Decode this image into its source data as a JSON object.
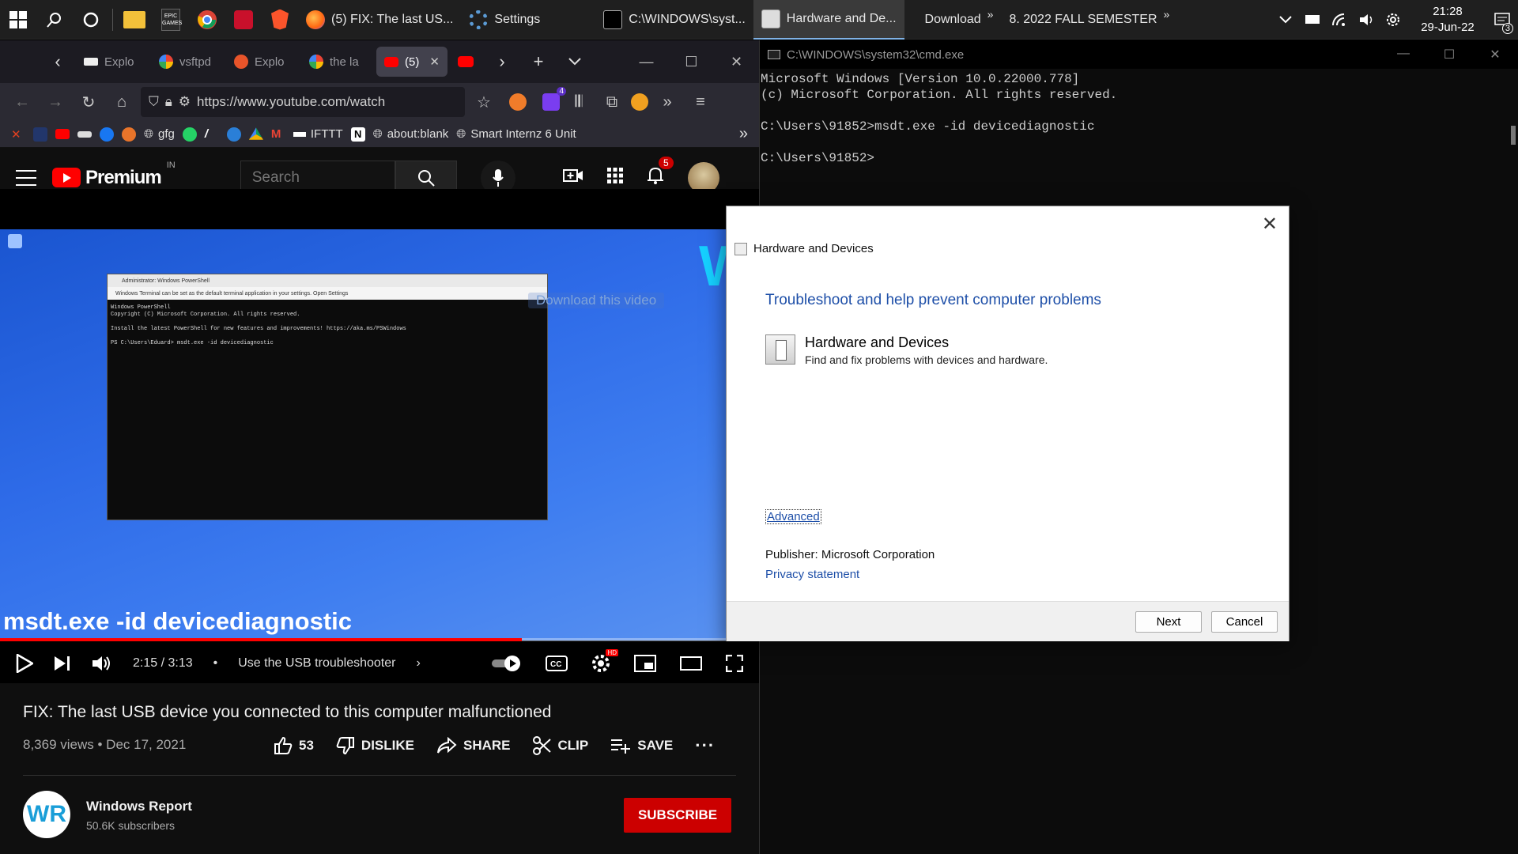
{
  "taskbar": {
    "apps": [
      {
        "label": "(5) FIX: The last US...",
        "icon": "firefox-icon"
      },
      {
        "label": "Settings",
        "icon": "gear-icon"
      },
      {
        "label": "C:\\WINDOWS\\syst...",
        "icon": "cmd-icon"
      },
      {
        "label": "Hardware and De...",
        "icon": "troubleshooter-icon"
      },
      {
        "label": "Download",
        "icon": "folder-icon"
      },
      {
        "label": "8. 2022 FALL SEMESTER",
        "icon": "folder-icon"
      }
    ],
    "clock": {
      "time": "21:28",
      "date": "29-Jun-22"
    },
    "notification_count": "3"
  },
  "browser": {
    "tabs": [
      {
        "label": "Explo"
      },
      {
        "label": "vsftpd"
      },
      {
        "label": "Explo"
      },
      {
        "label": "the la"
      },
      {
        "label": "(5)"
      }
    ],
    "url": "https://www.youtube.com/watch",
    "extension_badge": "4",
    "bookmarks": [
      {
        "label": "gfg"
      },
      {
        "label": "IFTTT"
      },
      {
        "label": "about:blank"
      },
      {
        "label": "Smart Internz 6 Unit"
      }
    ]
  },
  "youtube": {
    "logo_text": "Premium",
    "country": "IN",
    "search_placeholder": "Search",
    "notification_count": "5",
    "video": {
      "caption": "msdt.exe -id devicediagnostic",
      "overlay_download": "Download this video",
      "watermark": "W",
      "progress": 0.687,
      "time": "2:15 / 3:13",
      "chapter": "Use the USB troubleshooter",
      "inner_terminal_title": "Administrator: Windows PowerShell",
      "inner_terminal_info": "Windows Terminal can be set as the default terminal application in your settings.   Open Settings",
      "inner_terminal_lines": "Windows PowerShell\nCopyright (C) Microsoft Corporation. All rights reserved.\n\nInstall the latest PowerShell for new features and improvements! https://aka.ms/PSWindows\n\nPS C:\\Users\\Eduard> msdt.exe -id devicediagnostic"
    },
    "title": "FIX: The last USB device you connected to this computer malfunctioned",
    "meta": "8,369 views • Dec 17, 2021",
    "actions": {
      "likes": "53",
      "dislike": "DISLIKE",
      "share": "SHARE",
      "clip": "CLIP",
      "save": "SAVE"
    },
    "channel": {
      "name": "Windows Report",
      "subscribers": "50.6K subscribers",
      "avatar_text": "WR"
    },
    "subscribe_label": "SUBSCRIBE"
  },
  "cmd": {
    "title": "C:\\WINDOWS\\system32\\cmd.exe",
    "output": "Microsoft Windows [Version 10.0.22000.778]\n(c) Microsoft Corporation. All rights reserved.\n\nC:\\Users\\91852>msdt.exe -id devicediagnostic\n\nC:\\Users\\91852>"
  },
  "dialog": {
    "window_title": "Hardware and Devices",
    "heading": "Troubleshoot and help prevent computer problems",
    "item_title": "Hardware and Devices",
    "item_desc": "Find and fix problems with devices and hardware.",
    "advanced": "Advanced",
    "publisher": "Publisher:  Microsoft Corporation",
    "privacy": "Privacy statement",
    "next": "Next",
    "cancel": "Cancel"
  },
  "colors": {
    "yt_red": "#ff0000",
    "link_blue": "#1e4fa8",
    "taskbar_bg": "#1f1f1f"
  }
}
